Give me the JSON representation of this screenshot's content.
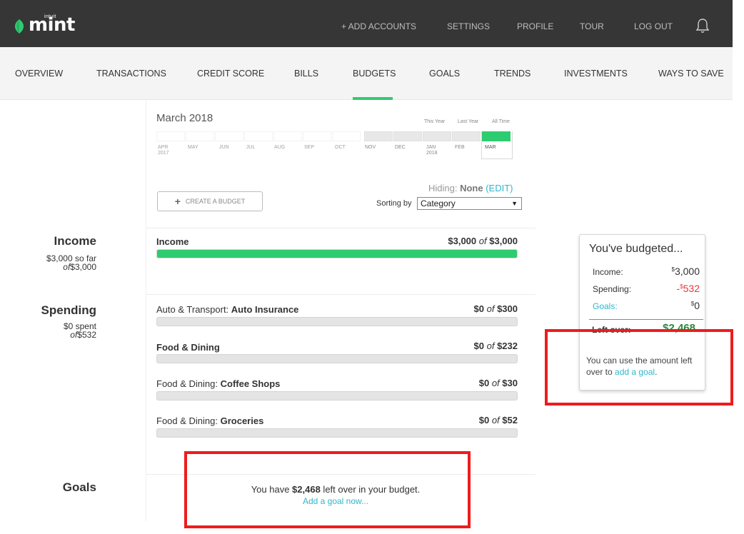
{
  "brand": {
    "small": "intuit",
    "name": "mint"
  },
  "top_nav": {
    "add_accounts": "+ ADD ACCOUNTS",
    "settings": "SETTINGS",
    "profile": "PROFILE",
    "tour": "TOUR",
    "logout": "LOG OUT",
    "bell_icon": "bell-icon"
  },
  "main_nav": {
    "items": [
      "OVERVIEW",
      "TRANSACTIONS",
      "CREDIT SCORE",
      "BILLS",
      "BUDGETS",
      "GOALS",
      "TRENDS",
      "INVESTMENTS",
      "WAYS TO SAVE"
    ],
    "active": "BUDGETS"
  },
  "calendar": {
    "title": "March 2018",
    "range_links": [
      "This Year",
      "Last Year",
      "All Time"
    ],
    "months": [
      {
        "m": "APR",
        "y": "2017"
      },
      {
        "m": "MAY",
        "y": ""
      },
      {
        "m": "JUN",
        "y": ""
      },
      {
        "m": "JUL",
        "y": ""
      },
      {
        "m": "AUG",
        "y": ""
      },
      {
        "m": "SEP",
        "y": ""
      },
      {
        "m": "OCT",
        "y": ""
      },
      {
        "m": "NOV",
        "y": ""
      },
      {
        "m": "DEC",
        "y": ""
      },
      {
        "m": "JAN",
        "y": "2018"
      },
      {
        "m": "FEB",
        "y": ""
      },
      {
        "m": "MAR",
        "y": ""
      }
    ],
    "selected": "MAR"
  },
  "controls": {
    "hiding_label": "Hiding:",
    "hiding_value": "None",
    "edit": "(EDIT)",
    "create_budget": "CREATE A BUDGET",
    "sorting_label": "Sorting by",
    "sorting_value": "Category"
  },
  "sections": {
    "income": {
      "title": "Income",
      "sub1": "$3,000 so far",
      "of_word": "of",
      "sub2": "$3,000"
    },
    "spending": {
      "title": "Spending",
      "sub1": "$0 spent",
      "of_word": "of",
      "sub2": "$532"
    },
    "goals": {
      "title": "Goals"
    }
  },
  "income_row": {
    "label": "Income",
    "spent": "$3,000",
    "of_word": "of",
    "budget": "$3,000",
    "progress": 1.0
  },
  "spending_rows": [
    {
      "category": "Auto & Transport: ",
      "name": "Auto Insurance",
      "spent": "$0",
      "of_word": "of",
      "budget": "$300",
      "progress": 0
    },
    {
      "category": "",
      "name": "Food & Dining",
      "spent": "$0",
      "of_word": "of",
      "budget": "$232",
      "progress": 0
    },
    {
      "category": "Food & Dining: ",
      "name": "Coffee Shops",
      "spent": "$0",
      "of_word": "of",
      "budget": "$30",
      "progress": 0
    },
    {
      "category": "Food & Dining: ",
      "name": "Groceries",
      "spent": "$0",
      "of_word": "of",
      "budget": "$52",
      "progress": 0
    }
  ],
  "goals_msg": {
    "pre": "You have ",
    "amount": "$2,468",
    "post": " left over in your budget.",
    "link": "Add a goal now..."
  },
  "summary_card": {
    "title": "You've budgeted...",
    "income_label": "Income:",
    "income_currency": "$",
    "income_value": "3,000",
    "spending_label": "Spending:",
    "spending_sign": "-",
    "spending_currency": "$",
    "spending_value": "532",
    "goals_label": "Goals:",
    "goals_currency": "$",
    "goals_value": "0",
    "leftover_label": "Left over:",
    "leftover_value": "$2,468",
    "note_pre": "You can use the amount left over to ",
    "note_link": "add a goal",
    "note_post": "."
  },
  "colors": {
    "accent_green": "#2ecc71",
    "link_blue": "#2fb6cc",
    "highlight_red": "#ee1c1c",
    "negative_red": "#e8383d",
    "topbar": "#363636"
  }
}
